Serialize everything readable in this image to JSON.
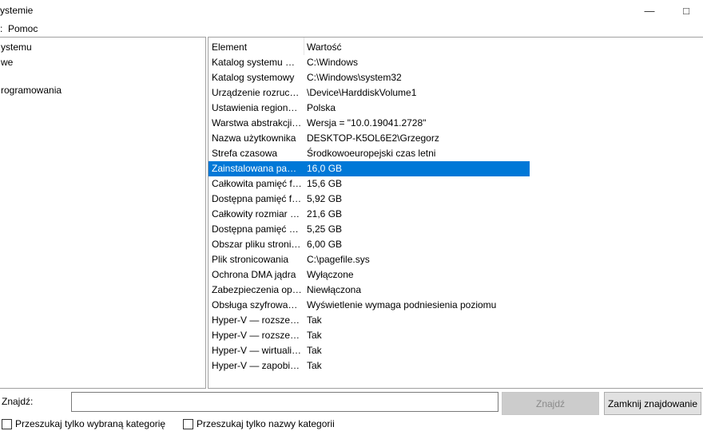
{
  "window": {
    "title": "ystemie"
  },
  "menu": {
    "items": [
      ":",
      "Pomoc"
    ]
  },
  "tree": {
    "items": [
      "ystemu",
      "we",
      "rogramowania"
    ]
  },
  "table": {
    "columns": [
      "Element",
      "Wartość"
    ],
    "rows": [
      {
        "element": "Katalog systemu Wi...",
        "value": "C:\\Windows"
      },
      {
        "element": "Katalog systemowy",
        "value": "C:\\Windows\\system32"
      },
      {
        "element": "Urządzenie rozrucho...",
        "value": "\\Device\\HarddiskVolume1"
      },
      {
        "element": "Ustawienia regionalne",
        "value": "Polska"
      },
      {
        "element": "Warstwa abstrakcji s...",
        "value": "Wersja = \"10.0.19041.2728\""
      },
      {
        "element": "Nazwa użytkownika",
        "value": "DESKTOP-K5OL6E2\\Grzegorz"
      },
      {
        "element": "Strefa czasowa",
        "value": "Środkowoeuropejski czas letni"
      },
      {
        "element": "Zainstalowana pami...",
        "value": "16,0 GB",
        "selected": true
      },
      {
        "element": "Całkowita pamięć fiz...",
        "value": "15,6 GB"
      },
      {
        "element": "Dostępna pamięć fiz...",
        "value": "5,92 GB"
      },
      {
        "element": "Całkowity rozmiar p...",
        "value": "21,6 GB"
      },
      {
        "element": "Dostępna pamięć wi...",
        "value": "5,25 GB"
      },
      {
        "element": "Obszar pliku stronic...",
        "value": "6,00 GB"
      },
      {
        "element": "Plik stronicowania",
        "value": "C:\\pagefile.sys"
      },
      {
        "element": "Ochrona DMA jądra",
        "value": "Wyłączone"
      },
      {
        "element": "Zabezpieczenia opar...",
        "value": "Niewłączona"
      },
      {
        "element": "Obsługa szyfrowania...",
        "value": "Wyświetlenie wymaga podniesienia poziomu"
      },
      {
        "element": "Hyper-V — rozszerz...",
        "value": "Tak"
      },
      {
        "element": "Hyper-V — rozszerz...",
        "value": "Tak"
      },
      {
        "element": "Hyper-V — wirtualiz...",
        "value": "Tak"
      },
      {
        "element": "Hyper-V — zapobie...",
        "value": "Tak"
      }
    ]
  },
  "find": {
    "label": "Znajdź:",
    "input_value": "",
    "find_button": "Znajdź",
    "close_button": "Zamknij znajdowanie",
    "checkbox_selected_category": "Przeszukaj tylko wybraną kategorię",
    "checkbox_category_names": "Przeszukaj tylko nazwy kategorii"
  },
  "icons": {
    "minimize": "minimize-icon",
    "maximize": "maximize-icon"
  },
  "colors": {
    "selection": "#0078d7",
    "border": "#a0a0a0"
  }
}
